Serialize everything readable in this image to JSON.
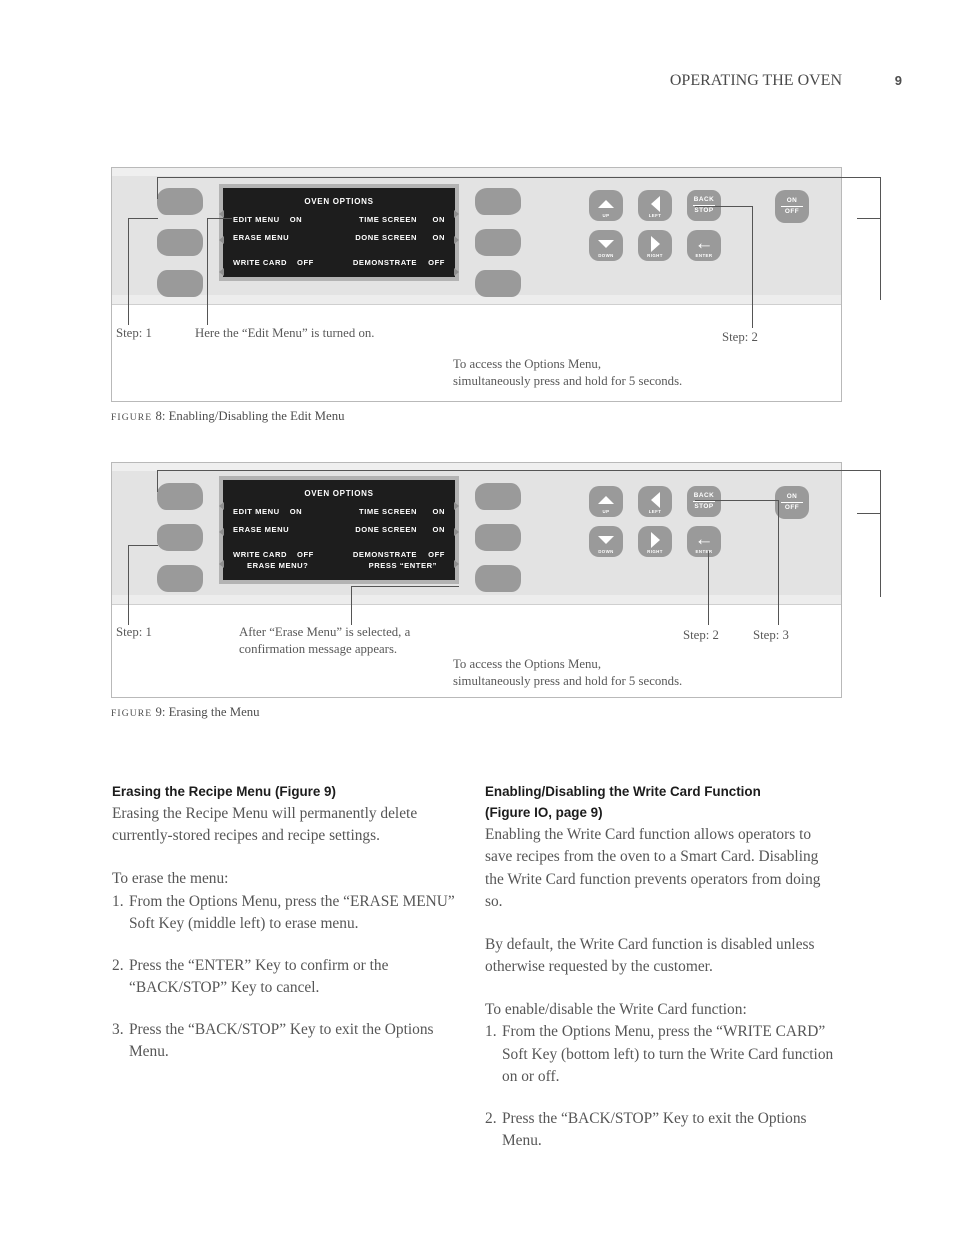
{
  "running_head": {
    "title": "OPERATING THE OVEN",
    "page_number": "9"
  },
  "figures": [
    {
      "id": "figure-8",
      "label_word": "FIGURE",
      "label_rest": "8: Enabling/Disabling the Edit Menu",
      "lcd": {
        "title": "OVEN OPTIONS",
        "rows": [
          {
            "left_label": "EDIT MENU",
            "left_value": "ON",
            "right_label": "TIME SCREEN",
            "right_value": "ON"
          },
          {
            "left_label": "ERASE MENU",
            "left_value": "",
            "right_label": "DONE SCREEN",
            "right_value": "ON"
          },
          {
            "left_label": "WRITE CARD",
            "left_value": "OFF",
            "right_label": "DEMONSTRATE",
            "right_value": "OFF"
          }
        ],
        "confirm_left": "",
        "confirm_right": ""
      },
      "keypad": {
        "up": "UP",
        "left": "LEFT",
        "back": "BACK",
        "stop": "STOP",
        "on": "ON",
        "off": "OFF",
        "down": "DOWN",
        "right": "RIGHT",
        "enter": "ENTER"
      },
      "captions": {
        "step1": "Step: 1",
        "step1_note": "Here the “Edit Menu” is turned on.",
        "step2": "Step: 2",
        "access_note": "To access the Options Menu,\nsimultaneously press and hold for 5 seconds."
      }
    },
    {
      "id": "figure-9",
      "label_word": "FIGURE",
      "label_rest": "9: Erasing the Menu",
      "lcd": {
        "title": "OVEN OPTIONS",
        "rows": [
          {
            "left_label": "EDIT MENU",
            "left_value": "ON",
            "right_label": "TIME SCREEN",
            "right_value": "ON"
          },
          {
            "left_label": "ERASE MENU",
            "left_value": "",
            "right_label": "DONE SCREEN",
            "right_value": "ON"
          },
          {
            "left_label": "WRITE CARD",
            "left_value": "OFF",
            "right_label": "DEMONSTRATE",
            "right_value": "OFF"
          }
        ],
        "confirm_left": "ERASE MENU?",
        "confirm_right": "PRESS “ENTER”"
      },
      "keypad": {
        "up": "UP",
        "left": "LEFT",
        "back": "BACK",
        "stop": "STOP",
        "on": "ON",
        "off": "OFF",
        "down": "DOWN",
        "right": "RIGHT",
        "enter": "ENTER"
      },
      "captions": {
        "step1": "Step: 1",
        "step1_note": "After “Erase Menu” is selected, a\nconfirmation message appears.",
        "step2": "Step: 2",
        "step3": "Step: 3",
        "access_note": "To access the Options Menu,\nsimultaneously press and hold for 5 seconds."
      }
    }
  ],
  "body": {
    "left_column": {
      "heading": "Erasing the Recipe Menu (Figure 9)",
      "intro": "Erasing the Recipe Menu will permanently delete currently-stored recipes and recipe settings.",
      "lead_in": "To erase the menu:",
      "steps": [
        {
          "number": "1.",
          "text": "From the Options Menu, press the “ERASE MENU” Soft Key (middle left) to erase menu."
        },
        {
          "number": "2.",
          "text": "Press the “ENTER” Key to confirm or the “BACK/STOP” Key to cancel."
        },
        {
          "number": "3.",
          "text": "Press the “BACK/STOP” Key to exit the Options Menu."
        }
      ]
    },
    "right_column": {
      "heading_line1": "Enabling/Disabling the Write Card Function",
      "heading_line2": "(Figure IO, page 9)",
      "intro": "Enabling the Write Card function allows operators to save recipes from the oven to a Smart Card. Disabling the Write Card function prevents operators from doing so.",
      "note": "By default, the Write Card function is disabled unless otherwise requested by the customer.",
      "lead_in": "To enable/disable the Write Card function:",
      "steps": [
        {
          "number": "1.",
          "text": "From the Options Menu, press the “WRITE CARD” Soft Key (bottom left) to turn the Write Card function on or off."
        },
        {
          "number": "2.",
          "text": "Press the “BACK/STOP” Key to exit the Options Menu."
        }
      ]
    }
  },
  "colors": {
    "panel": "#e3e3e3",
    "key": "#9a9a9a",
    "lcd": "#1d1d1d",
    "text": "#565656"
  }
}
